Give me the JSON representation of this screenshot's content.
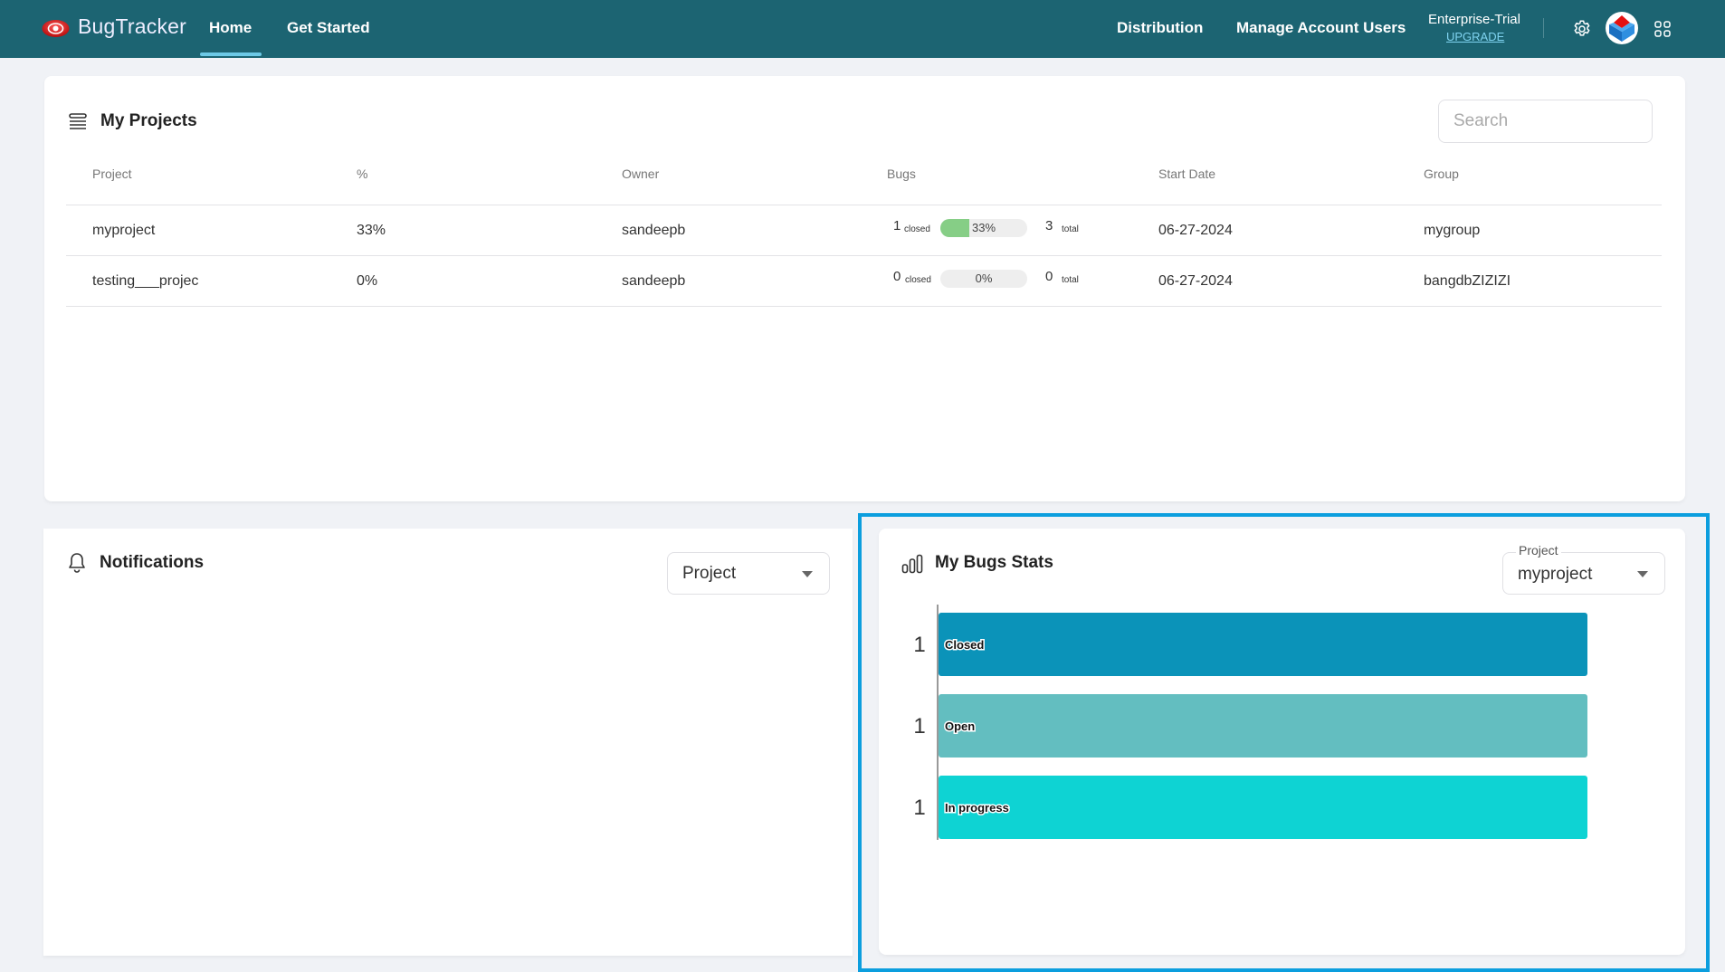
{
  "navbar": {
    "brand": "BugTracker",
    "links": [
      {
        "label": "Home",
        "active": true
      },
      {
        "label": "Get Started",
        "active": false
      },
      {
        "label": "Distribution",
        "active": false
      },
      {
        "label": "Manage Account Users",
        "active": false
      }
    ],
    "plan": {
      "name": "Enterprise-Trial",
      "upgrade_label": "UPGRADE"
    },
    "icons": [
      "bug-logo-icon",
      "gear-icon",
      "avatar",
      "apps-grid-icon"
    ],
    "colors": {
      "bar": "#1c6472",
      "active_underline": "#6cc9e6",
      "upgrade_link": "#7fd3f0"
    }
  },
  "projects": {
    "title": "My Projects",
    "search": {
      "placeholder": "Search",
      "value": ""
    },
    "columns": [
      "Project",
      "%",
      "Owner",
      "Bugs",
      "Start Date",
      "Group"
    ],
    "rows": [
      {
        "project": "myproject",
        "percent": "33%",
        "owner": "sandeepb",
        "bugs": {
          "closed": "1",
          "closed_label": "closed",
          "progress": 33,
          "progress_label": "33%",
          "total": "3",
          "total_label": "total"
        },
        "start_date": "06-27-2024",
        "group": "mygroup"
      },
      {
        "project": "testing___projec",
        "percent": "0%",
        "owner": "sandeepb",
        "bugs": {
          "closed": "0",
          "closed_label": "closed",
          "progress": 0,
          "progress_label": "0%",
          "total": "0",
          "total_label": "total"
        },
        "start_date": "06-27-2024",
        "group": "bangdbZIZIZI"
      }
    ]
  },
  "notifications": {
    "title": "Notifications",
    "filter": {
      "value": "Project"
    }
  },
  "bug_stats": {
    "title": "My Bugs Stats",
    "project_select": {
      "label": "Project",
      "value": "myproject"
    }
  },
  "chart_data": {
    "type": "bar",
    "orientation": "horizontal",
    "title": "My Bugs Stats",
    "categories": [
      "Closed",
      "Open",
      "In progress"
    ],
    "values": [
      1,
      1,
      1
    ],
    "colors": [
      "#0b93b9",
      "#63bec0",
      "#0ed3d3"
    ],
    "xlabel": "",
    "ylabel": "",
    "xlim": [
      0,
      1
    ],
    "grid": false,
    "legend": "none"
  },
  "highlight_color": "#0c9ede"
}
